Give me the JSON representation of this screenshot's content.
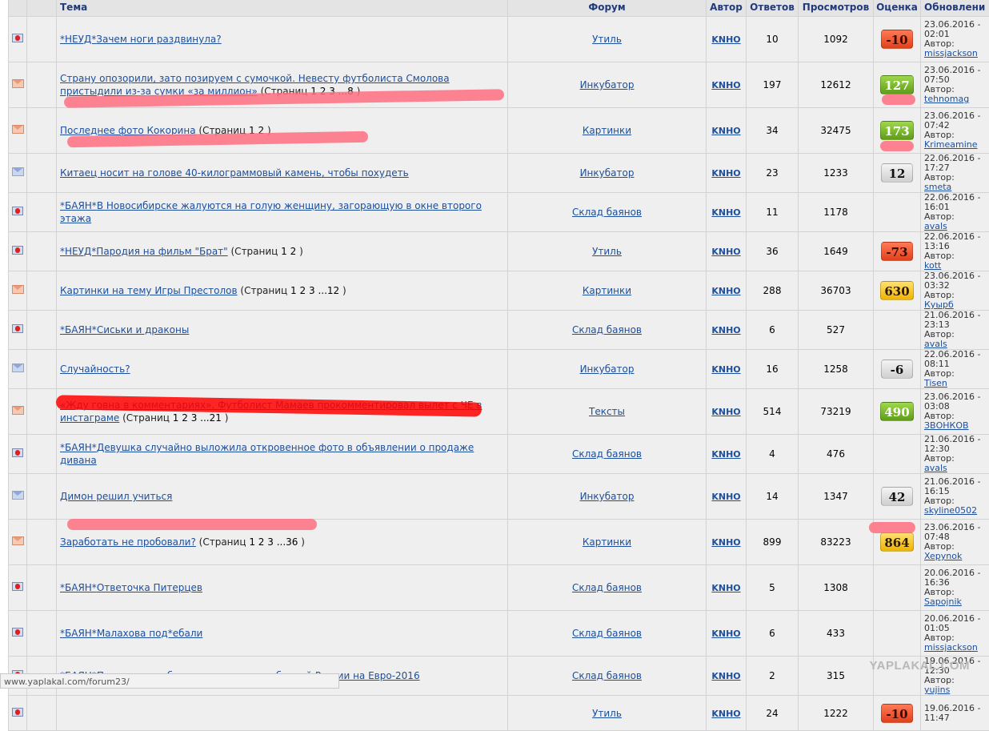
{
  "columns": {
    "topic": "Тема",
    "forum": "Форум",
    "author": "Автор",
    "replies": "Ответов",
    "views": "Просмотров",
    "rating": "Оценка",
    "updated": "Обновлени"
  },
  "rows": [
    {
      "icon": "red",
      "height": 57,
      "tag": "*НЕУД*",
      "title": "Зачем ноги раздвинула?",
      "pages_label": "",
      "pages": [],
      "forum": "Утиль",
      "author": "KNHO",
      "replies": "10",
      "views": "1092",
      "score": "-10",
      "score_type": "neg",
      "upd_date": "23.06.2016 -",
      "upd_time": "02:01",
      "upd_label": "Автор:",
      "upd_author": "missjackson"
    },
    {
      "icon": "env-hot",
      "height": 57,
      "tag": "",
      "title": "Страну опозорили, зато позируем с сумочкой. Невесту футболиста Смолова пристыдили из-за сумки «за миллион»",
      "pages_label": " (Страниц ",
      "pages": [
        "1",
        "2",
        "3",
        "...8"
      ],
      "forum": "Инкубатор",
      "author": "KNHO",
      "replies": "197",
      "views": "12612",
      "score": "127",
      "score_type": "pos",
      "upd_date": "23.06.2016 -",
      "upd_time": "07:50",
      "upd_label": "Автор:",
      "upd_author": "tehnomag"
    },
    {
      "icon": "env-hot",
      "height": 57,
      "tag": "",
      "title": "Последнее фото Кокорина",
      "pages_label": " (Страниц ",
      "pages": [
        "1",
        "2"
      ],
      "forum": "Картинки",
      "author": "KNHO",
      "replies": "34",
      "views": "32475",
      "score": "173",
      "score_type": "pos",
      "upd_date": "23.06.2016 -",
      "upd_time": "07:42",
      "upd_label": "Автор:",
      "upd_author": "Krimeamine"
    },
    {
      "icon": "env",
      "height": 44,
      "tag": "",
      "title": "Китаец носит на голове 40-килограммовый камень, чтобы похудеть",
      "pages_label": "",
      "pages": [],
      "forum": "Инкубатор",
      "author": "KNHO",
      "replies": "23",
      "views": "1233",
      "score": "12",
      "score_type": "gray",
      "upd_date": "22.06.2016 -",
      "upd_time": "17:27",
      "upd_label": "Автор:",
      "upd_author": "smeta"
    },
    {
      "icon": "red",
      "height": 44,
      "tag": "*БАЯН*",
      "title": "В Новосибирске жалуются на голую женщину, загорающую в окне второго этажа",
      "pages_label": "",
      "pages": [],
      "forum": "Склад баянов",
      "author": "KNHO",
      "replies": "11",
      "views": "1178",
      "score": "",
      "score_type": "",
      "upd_date": "22.06.2016 -",
      "upd_time": "16:01",
      "upd_label": "Автор:",
      "upd_author": "avals"
    },
    {
      "icon": "red",
      "height": 44,
      "tag": "*НЕУД*",
      "title": "Пародия на фильм \"Брат\"",
      "pages_label": " (Страниц ",
      "pages": [
        "1",
        "2"
      ],
      "forum": "Утиль",
      "author": "KNHO",
      "replies": "36",
      "views": "1649",
      "score": "-73",
      "score_type": "neg",
      "upd_date": "22.06.2016 -",
      "upd_time": "13:16",
      "upd_label": "Автор:",
      "upd_author": "kott"
    },
    {
      "icon": "env-hot",
      "height": 44,
      "tag": "",
      "title": "Картинки на тему Игры Престолов",
      "pages_label": " (Страниц ",
      "pages": [
        "1",
        "2",
        "3",
        "...12"
      ],
      "forum": "Картинки",
      "author": "KNHO",
      "replies": "288",
      "views": "36703",
      "score": "630",
      "score_type": "gold",
      "upd_date": "23.06.2016 -",
      "upd_time": "03:32",
      "upd_label": "Автор:",
      "upd_author": "Куырб"
    },
    {
      "icon": "red",
      "height": 44,
      "tag": "*БАЯН*",
      "title": "Сиськи и драконы",
      "pages_label": "",
      "pages": [],
      "forum": "Склад баянов",
      "author": "KNHO",
      "replies": "6",
      "views": "527",
      "score": "",
      "score_type": "",
      "upd_date": "21.06.2016 -",
      "upd_time": "23:13",
      "upd_label": "Автор:",
      "upd_author": "avals"
    },
    {
      "icon": "env",
      "height": 44,
      "tag": "",
      "title": "Случайность?",
      "pages_label": "",
      "pages": [],
      "forum": "Инкубатор",
      "author": "KNHO",
      "replies": "16",
      "views": "1258",
      "score": "-6",
      "score_type": "gray",
      "upd_date": "22.06.2016 -",
      "upd_time": "08:11",
      "upd_label": "Автор:",
      "upd_author": "Tisen"
    },
    {
      "icon": "env-hot",
      "height": 57,
      "tag": "",
      "title": "«Жду говна в комментариях». Футболист Мамаев прокомментировал вылет с ЧЕ в инстаграме",
      "pages_label": " (Страниц ",
      "pages": [
        "1",
        "2",
        "3",
        "...21"
      ],
      "forum": "Тексты",
      "author": "KNHO",
      "replies": "514",
      "views": "73219",
      "score": "490",
      "score_type": "pos",
      "upd_date": "23.06.2016 -",
      "upd_time": "03:08",
      "upd_label": "Автор:",
      "upd_author": "ЗВОНКОВ"
    },
    {
      "icon": "red",
      "height": 44,
      "tag": "*БАЯН*",
      "title": "Девушка случайно выложила откровенное фото в объявлении о продаже дивана",
      "pages_label": "",
      "pages": [],
      "forum": "Склад баянов",
      "author": "KNHO",
      "replies": "4",
      "views": "476",
      "score": "",
      "score_type": "",
      "upd_date": "21.06.2016 -",
      "upd_time": "12:30",
      "upd_label": "Автор:",
      "upd_author": "avals"
    },
    {
      "icon": "env",
      "height": 57,
      "tag": "",
      "title": "Димон решил учиться",
      "pages_label": "",
      "pages": [],
      "forum": "Инкубатор",
      "author": "KNHO",
      "replies": "14",
      "views": "1347",
      "score": "42",
      "score_type": "gray",
      "upd_date": "21.06.2016 -",
      "upd_time": "16:15",
      "upd_label": "Автор:",
      "upd_author": "skyline0502"
    },
    {
      "icon": "env-hot",
      "height": 57,
      "tag": "",
      "title": "Заработать не пробовали?",
      "pages_label": " (Страниц ",
      "pages": [
        "1",
        "2",
        "3",
        "...36"
      ],
      "forum": "Картинки",
      "author": "KNHO",
      "replies": "899",
      "views": "83223",
      "score": "864",
      "score_type": "gold",
      "upd_date": "23.06.2016 -",
      "upd_time": "07:48",
      "upd_label": "Автор:",
      "upd_author": "Xepynok"
    },
    {
      "icon": "red",
      "height": 57,
      "tag": "*БАЯН*",
      "title": "Ответочка Питерцев",
      "pages_label": "",
      "pages": [],
      "forum": "Склад баянов",
      "author": "KNHO",
      "replies": "5",
      "views": "1308",
      "score": "",
      "score_type": "",
      "upd_date": "20.06.2016 -",
      "upd_time": "16:36",
      "upd_label": "Автор:",
      "upd_author": "Sapojnik"
    },
    {
      "icon": "red",
      "height": 57,
      "tag": "*БАЯН*",
      "title": "Малахова под*ебали",
      "pages_label": "",
      "pages": [],
      "forum": "Склад баянов",
      "author": "KNHO",
      "replies": "6",
      "views": "433",
      "score": "",
      "score_type": "",
      "upd_date": "20.06.2016 -",
      "upd_time": "01:05",
      "upd_label": "Автор:",
      "upd_author": "missjackson"
    },
    {
      "icon": "red",
      "height": 44,
      "tag": "*БАЯН*",
      "title": "Порнозвезды бросили секс-вызов сборной России на Евро-2016",
      "pages_label": "",
      "pages": [],
      "forum": "Склад баянов",
      "author": "KNHO",
      "replies": "2",
      "views": "315",
      "score": "",
      "score_type": "",
      "upd_date": "19.06.2016 -",
      "upd_time": "12:30",
      "upd_label": "Автор:",
      "upd_author": "yujins"
    },
    {
      "icon": "red",
      "height": 44,
      "tag": "",
      "title": "",
      "pages_label": "",
      "pages": [],
      "forum": "Утиль",
      "author": "KNHO",
      "replies": "24",
      "views": "1222",
      "score": "-10",
      "score_type": "neg",
      "upd_date": "19.06.2016 -",
      "upd_time": "11:47",
      "upd_label": "",
      "upd_author": ""
    }
  ],
  "scribble_colors": {
    "pink": "#ff6f80",
    "red": "#ff0000"
  },
  "status_url": "www.yaplakal.com/forum23/",
  "watermark": "YAPLAKAL.COM"
}
